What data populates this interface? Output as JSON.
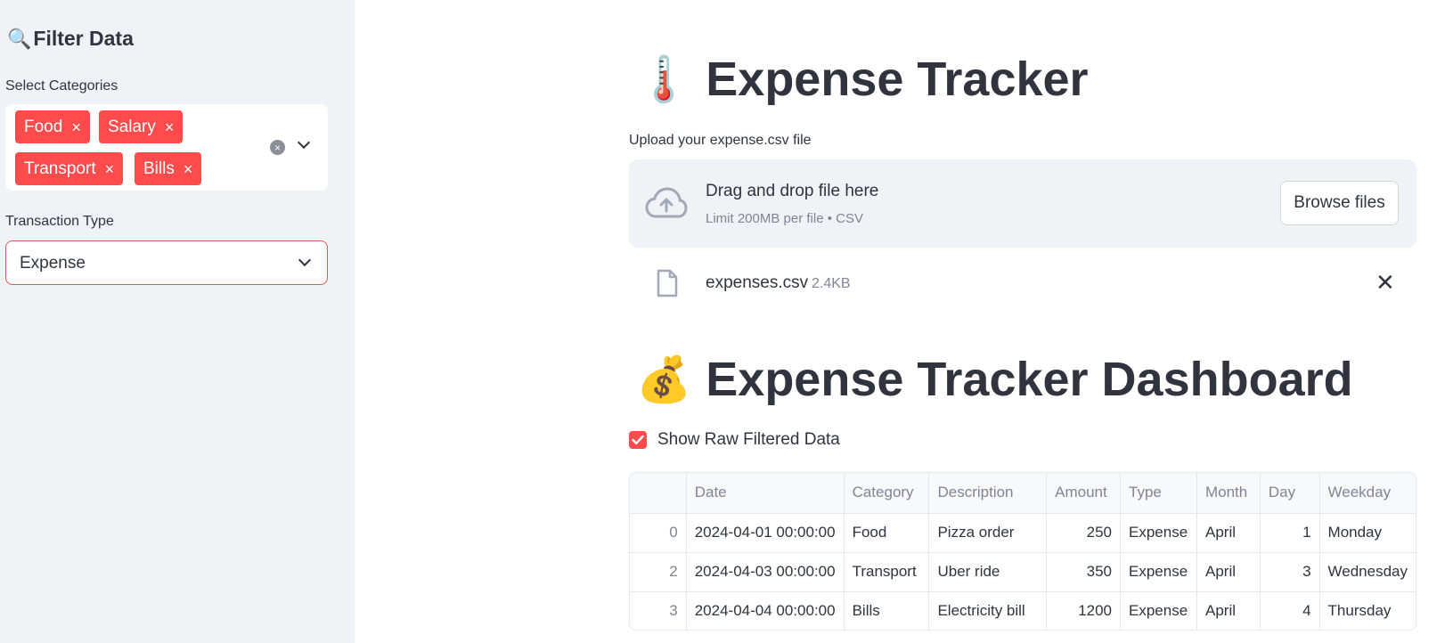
{
  "sidebar": {
    "title": "Filter Data",
    "title_icon": "magnifier-icon",
    "categories_label": "Select Categories",
    "selected_categories": [
      "Food",
      "Salary",
      "Transport",
      "Bills"
    ],
    "transaction_type_label": "Transaction Type",
    "transaction_type_value": "Expense"
  },
  "main": {
    "title": "Expense Tracker",
    "title_emoji": "🌡️",
    "upload": {
      "label": "Upload your expense.csv file",
      "drop_text": "Drag and drop file here",
      "limit_text": "Limit 200MB per file • CSV",
      "browse_label": "Browse files",
      "file_name": "expenses.csv",
      "file_size": "2.4KB"
    },
    "dashboard_title": "Expense Tracker Dashboard",
    "dashboard_emoji": "💰",
    "show_raw_label": "Show Raw Filtered Data",
    "show_raw_checked": true,
    "table": {
      "columns": [
        "",
        "Date",
        "Category",
        "Description",
        "Amount",
        "Type",
        "Month",
        "Day",
        "Weekday"
      ],
      "rows": [
        [
          "0",
          "2024-04-01 00:00:00",
          "Food",
          "Pizza order",
          "250",
          "Expense",
          "April",
          "1",
          "Monday"
        ],
        [
          "2",
          "2024-04-03 00:00:00",
          "Transport",
          "Uber ride",
          "350",
          "Expense",
          "April",
          "3",
          "Wednesday"
        ],
        [
          "3",
          "2024-04-04 00:00:00",
          "Bills",
          "Electricity bill",
          "1200",
          "Expense",
          "April",
          "4",
          "Thursday"
        ]
      ]
    }
  },
  "colors": {
    "accent": "#ff4b4b",
    "sidebar_bg": "#f0f2f6",
    "text": "#31333f",
    "muted": "#808495"
  }
}
